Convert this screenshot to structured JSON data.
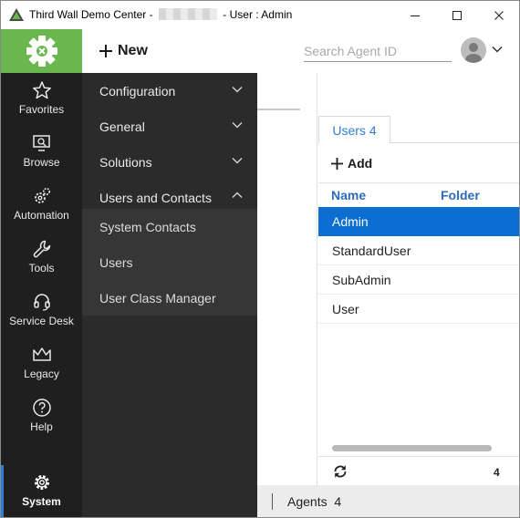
{
  "window": {
    "title_prefix": "Third Wall Demo Center -",
    "title_suffix": "- User : Admin",
    "controls": {
      "minimize": "minimize",
      "maximize": "maximize",
      "close": "close"
    }
  },
  "header": {
    "new_label": "New",
    "search_placeholder": "Search Agent ID"
  },
  "leftnav": {
    "items": [
      {
        "label": "Favorites",
        "icon": "star-icon"
      },
      {
        "label": "Browse",
        "icon": "monitor-search-icon"
      },
      {
        "label": "Automation",
        "icon": "gears-icon"
      },
      {
        "label": "Tools",
        "icon": "wrench-icon"
      },
      {
        "label": "Service Desk",
        "icon": "headset-icon"
      },
      {
        "label": "Legacy",
        "icon": "crown-icon"
      },
      {
        "label": "Help",
        "icon": "help-icon"
      },
      {
        "label": "System",
        "icon": "gear-icon"
      }
    ],
    "active": "System"
  },
  "flyout": {
    "sections": [
      {
        "label": "Configuration",
        "expanded": false
      },
      {
        "label": "General",
        "expanded": false
      },
      {
        "label": "Solutions",
        "expanded": false
      },
      {
        "label": "Users and Contacts",
        "expanded": true
      }
    ],
    "subitems": [
      "System Contacts",
      "Users",
      "User Class Manager"
    ]
  },
  "panel": {
    "tab_label": "Users 4",
    "add_label": "Add",
    "columns": [
      "Name",
      "Folder"
    ],
    "rows": [
      "Admin",
      "StandardUser",
      "SubAdmin",
      "User"
    ],
    "selected_row": "Admin",
    "count": "4"
  },
  "statusbar": {
    "agents_label": "Agents",
    "agents_count": "4"
  },
  "colors": {
    "accent_green": "#6ab750",
    "accent_blue": "#0a6fd1",
    "nav_bg": "#1f1f1f",
    "flyout_bg": "#2b2b2b"
  }
}
